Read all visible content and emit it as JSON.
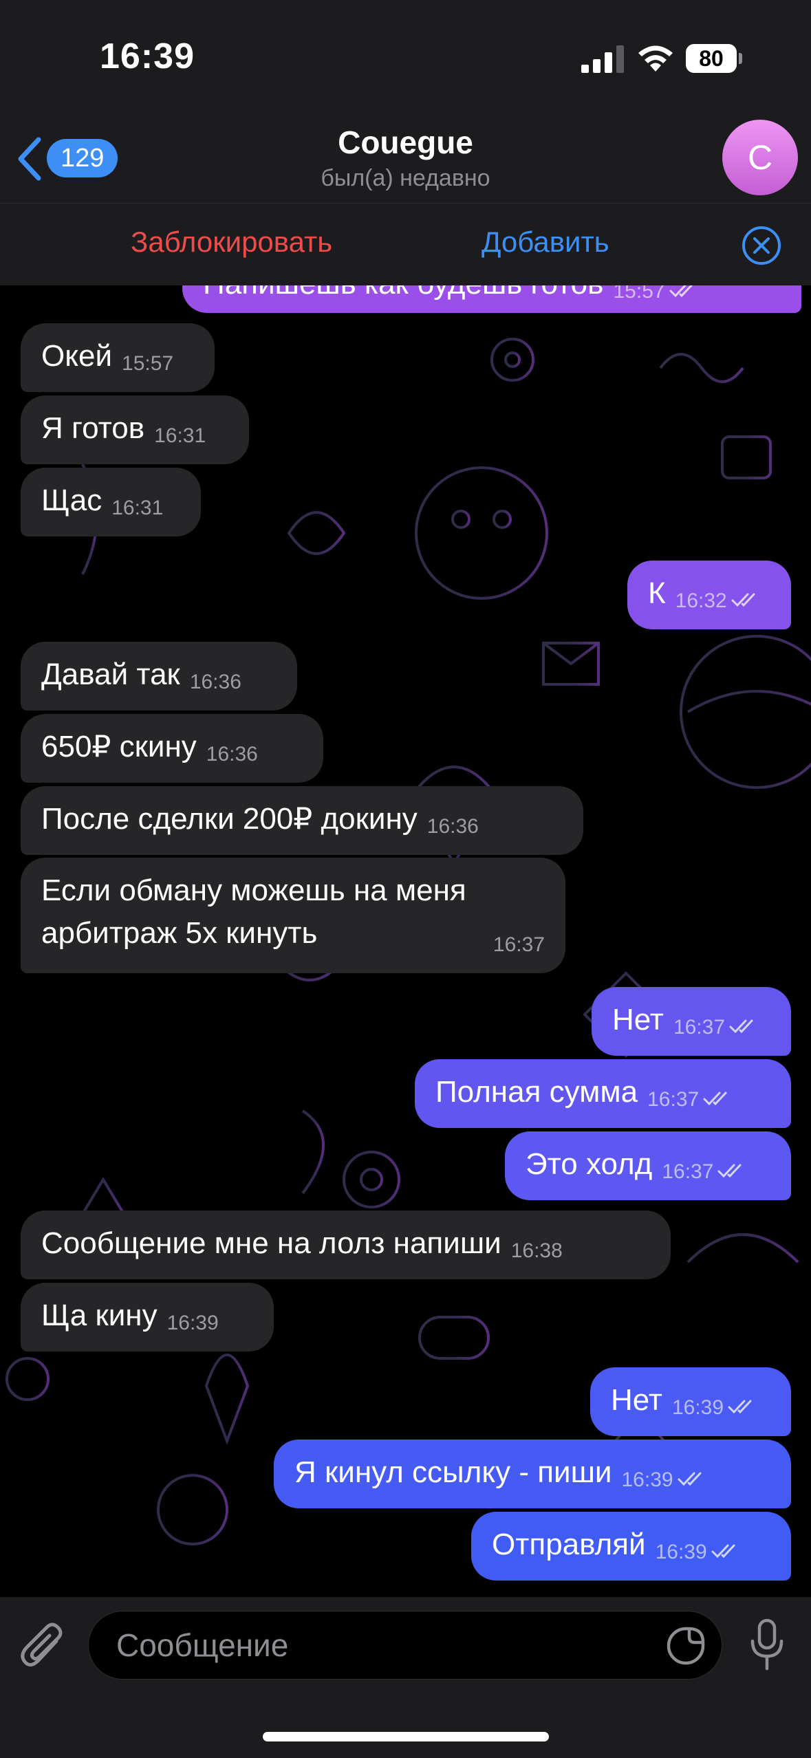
{
  "status_bar": {
    "time": "16:39",
    "battery": "80",
    "icons": [
      "signal-icon",
      "wifi-icon",
      "battery-icon"
    ]
  },
  "header": {
    "back_badge": "129",
    "title": "Couegue",
    "status": "был(а) недавно",
    "avatar_letter": "C",
    "avatar_color": "#d57ae2"
  },
  "action_bar": {
    "block_label": "Заблокировать",
    "add_label": "Добавить",
    "block_color": "#ee4b4b",
    "add_color": "#3e8ff5"
  },
  "messages": [
    {
      "dir": "out",
      "text": "Напишешь как будешь готов",
      "time": "15:57",
      "read": true
    },
    {
      "dir": "in",
      "text": "Окей",
      "time": "15:57"
    },
    {
      "dir": "in",
      "text": "Я готов",
      "time": "16:31"
    },
    {
      "dir": "in",
      "text": "Щас",
      "time": "16:31"
    },
    {
      "dir": "out",
      "text": "К",
      "time": "16:32",
      "read": true
    },
    {
      "dir": "in",
      "text": "Давай так",
      "time": "16:36"
    },
    {
      "dir": "in",
      "text": "650₽ скину",
      "time": "16:36"
    },
    {
      "dir": "in",
      "text": "После сделки 200₽ докину",
      "time": "16:36"
    },
    {
      "dir": "in",
      "text": "Если обману можешь на меня арбитраж 5х кинуть",
      "time": "16:37"
    },
    {
      "dir": "out",
      "text": "Нет",
      "time": "16:37",
      "read": true
    },
    {
      "dir": "out",
      "text": "Полная сумма",
      "time": "16:37",
      "read": true
    },
    {
      "dir": "out",
      "text": "Это холд",
      "time": "16:37",
      "read": true
    },
    {
      "dir": "in",
      "text": "Сообщение мне на лолз напиши",
      "time": "16:38"
    },
    {
      "dir": "in",
      "text": "Ща кину",
      "time": "16:39"
    },
    {
      "dir": "out",
      "text": "Нет",
      "time": "16:39",
      "read": true
    },
    {
      "dir": "out",
      "text": "Я кинул ссылку - пиши",
      "time": "16:39",
      "read": true
    },
    {
      "dir": "out",
      "text": "Отправляй",
      "time": "16:39",
      "read": true
    }
  ],
  "input": {
    "placeholder": "Сообщение"
  },
  "colors": {
    "incoming_bubble": "#262628",
    "outgoing_top": "#9b4fe9",
    "outgoing_bottom": "#3d5cf5"
  }
}
